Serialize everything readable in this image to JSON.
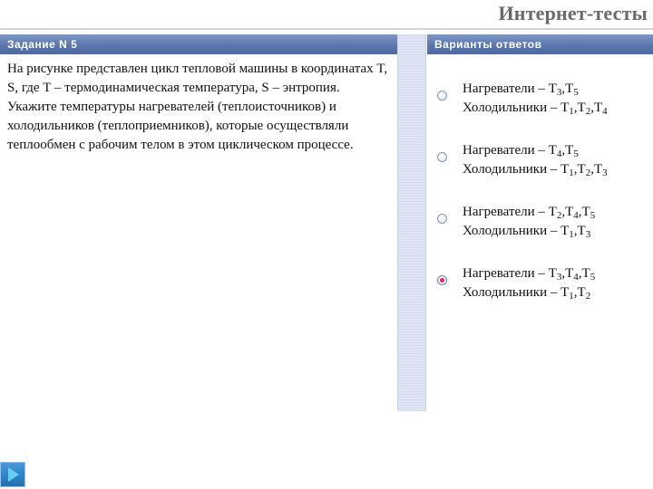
{
  "brand": {
    "title": "Интернет-тесты"
  },
  "task": {
    "header": "Задание N 5",
    "question": "На рисунке представлен цикл тепловой машины в координатах T, S, где T – термодинамическая температура, S – энтропия. Укажите температуры нагревателей (теплоисточников) и холодильников (теплоприемников), которые осуществляли теплообмен с рабочим телом в этом циклическом процессе."
  },
  "answers_panel": {
    "header": "Варианты ответов",
    "options": [
      {
        "heaters_label": "Нагреватели – ",
        "heaters": [
          "3",
          "5"
        ],
        "coolers_label": "Холодильники – ",
        "coolers": [
          "1",
          "2",
          "4"
        ],
        "selected": false
      },
      {
        "heaters_label": "Нагреватели – ",
        "heaters": [
          "4",
          "5"
        ],
        "coolers_label": "Холодильники – ",
        "coolers": [
          "1",
          "2",
          "3"
        ],
        "selected": false
      },
      {
        "heaters_label": "Нагреватели – ",
        "heaters": [
          "2",
          "4",
          "5"
        ],
        "coolers_label": "Холодильники – ",
        "coolers": [
          "1",
          "3"
        ],
        "selected": false
      },
      {
        "heaters_label": "Нагреватели – ",
        "heaters": [
          "3",
          "4",
          "5"
        ],
        "coolers_label": "Холодильники – ",
        "coolers": [
          "1",
          "2"
        ],
        "selected": true
      }
    ]
  },
  "symbols": {
    "temperature": "T",
    "separator": ","
  },
  "icons": {
    "nav_next": "play-arrow-icon",
    "radio_selected_color": "#e0245e"
  },
  "colors": {
    "header_bg": "#5a76ad",
    "divider_bg": "#dfe5f4",
    "brand_text": "#6a6a6a"
  }
}
